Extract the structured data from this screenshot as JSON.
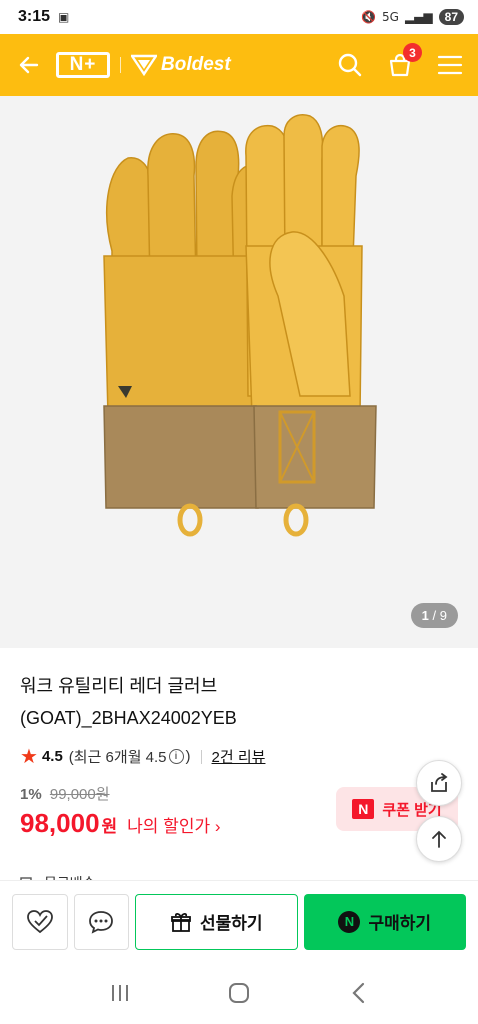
{
  "status_bar": {
    "time": "3:15",
    "network": "5G",
    "battery": "87"
  },
  "header": {
    "nplus_label": "N+",
    "brand_name": "Boldest",
    "cart_count": "3",
    "colors": {
      "background": "#fdbd10"
    }
  },
  "product": {
    "image_alt": "leather work gloves",
    "image_counter_current": "1",
    "image_counter_total": "/ 9",
    "title_line1": "워크 유틸리티 레더 글러브",
    "title_line2": "(GOAT)_2BHAX24002YEB",
    "rating": "4.5",
    "rating_sub": "(최근 6개월 4.5",
    "rating_sub_close": ")",
    "review_link": "2건 리뷰",
    "discount_rate": "1%",
    "original_price": "99,000원",
    "sale_price": "98,000",
    "sale_unit": "원",
    "my_price_label": "나의 할인가",
    "coupon_label": "쿠폰 받기",
    "shipping": "무료배송"
  },
  "actions": {
    "gift_label": "선물하기",
    "buy_label": "구매하기",
    "buy_badge": "N"
  }
}
